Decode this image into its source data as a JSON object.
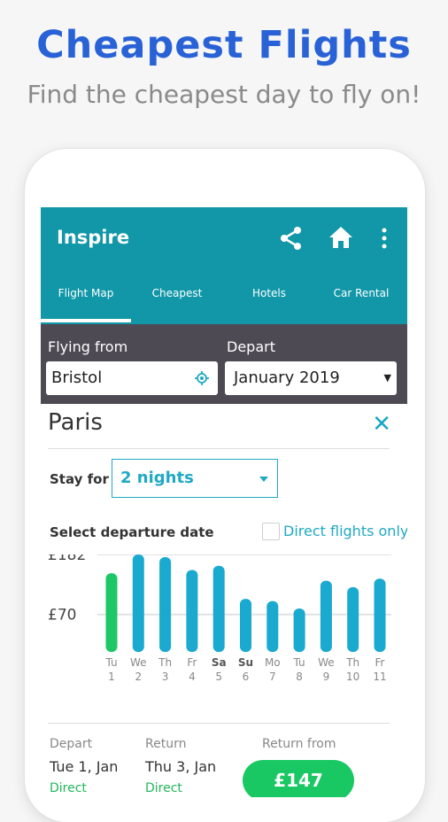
{
  "promo": {
    "title": "Cheapest Flights",
    "subtitle": "Find the cheapest day to fly on!"
  },
  "appbar": {
    "title": "Inspire",
    "icons": [
      "share-icon",
      "home-icon",
      "more-vert-icon"
    ],
    "color": "#1197a8"
  },
  "tabs": [
    {
      "label": "Flight Map",
      "active": true
    },
    {
      "label": "Cheapest",
      "active": false
    },
    {
      "label": "Hotels",
      "active": false
    },
    {
      "label": "Car Rental",
      "active": false
    }
  ],
  "search": {
    "from_label": "Flying from",
    "from_value": "Bristol",
    "depart_label": "Depart",
    "depart_value": "January 2019"
  },
  "card": {
    "destination": "Paris",
    "stay_label": "Stay for",
    "stay_value": "2 nights",
    "select_label": "Select departure date",
    "direct_only_label": "Direct flights only"
  },
  "summary": {
    "depart_label": "Depart",
    "depart_value": "Tue 1, Jan",
    "depart_type": "Direct",
    "return_label": "Return",
    "return_value": "Thu 3, Jan",
    "return_type": "Direct",
    "price_label": "Return from",
    "price_value": "£147"
  },
  "colors": {
    "accent": "#20a9c3",
    "bar": "#1aa9cf",
    "bar_selected": "#1ec765",
    "panel": "#4d4a54",
    "price": "#19c862",
    "promo_title": "#2962d6"
  },
  "chart_data": {
    "type": "bar",
    "tick_labels": [
      "£182",
      "£70"
    ],
    "ylim": [
      0,
      182
    ],
    "categories": [
      {
        "day": "Tu",
        "date": "1",
        "selected": true,
        "weekend": false
      },
      {
        "day": "We",
        "date": "2",
        "selected": false,
        "weekend": false
      },
      {
        "day": "Th",
        "date": "3",
        "selected": false,
        "weekend": false
      },
      {
        "day": "Fr",
        "date": "4",
        "selected": false,
        "weekend": false
      },
      {
        "day": "Sa",
        "date": "5",
        "selected": false,
        "weekend": true
      },
      {
        "day": "Su",
        "date": "6",
        "selected": false,
        "weekend": true
      },
      {
        "day": "Mo",
        "date": "7",
        "selected": false,
        "weekend": false
      },
      {
        "day": "Tu",
        "date": "8",
        "selected": false,
        "weekend": false
      },
      {
        "day": "We",
        "date": "9",
        "selected": false,
        "weekend": false
      },
      {
        "day": "Th",
        "date": "10",
        "selected": false,
        "weekend": false
      },
      {
        "day": "Fr",
        "date": "11",
        "selected": false,
        "weekend": false
      }
    ],
    "values": [
      147,
      182,
      177,
      153,
      161,
      99,
      95,
      81,
      133,
      121,
      137
    ],
    "grid": true
  }
}
